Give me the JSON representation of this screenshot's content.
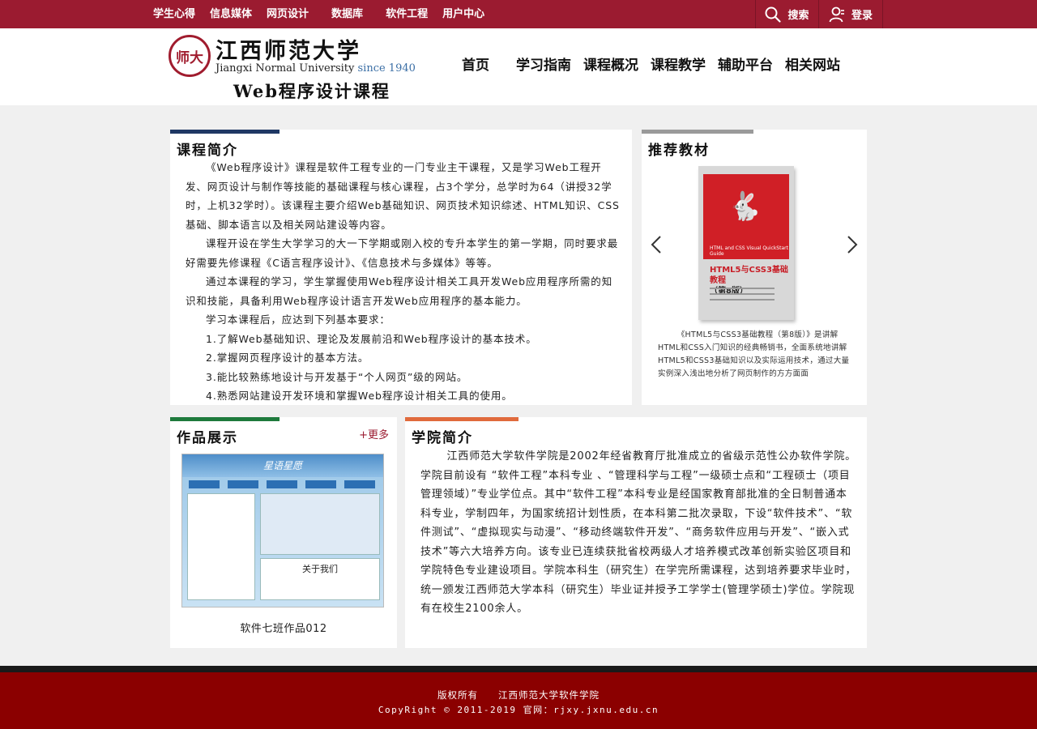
{
  "topnav": {
    "items": [
      "学生心得",
      "信息媒体",
      "网页设计",
      "数据库",
      "软件工程",
      "用户中心"
    ],
    "search_label": "搜索",
    "login_label": "登录"
  },
  "header": {
    "logo_name": "江西师范大学",
    "logo_en": "Jiangxi Normal University",
    "logo_since": "since 1940",
    "logo_seal": "师大",
    "course_title": "Web程序设计课程",
    "nav": [
      "首页",
      "学习指南",
      "课程概况",
      "课程教学",
      "辅助平台",
      "相关网站"
    ]
  },
  "intro": {
    "title": "课程简介",
    "paragraphs": [
      "《Web程序设计》课程是软件工程专业的一门专业主干课程，又是学习Web工程开发、网页设计与制作等技能的基础课程与核心课程，占3个学分，总学时为64（讲授32学时，上机32学时）。该课程主要介绍Web基础知识、网页技术知识综述、HTML知识、CSS基础、脚本语言以及相关网站建设等内容。",
      "课程开设在学生大学学习的大一下学期或刚入校的专升本学生的第一学期，同时要求最好需要先修课程《C语言程序设计》、《信息技术与多媒体》等等。",
      "通过本课程的学习，学生掌握使用Web程序设计相关工具开发Web应用程序所需的知识和技能，具备利用Web程序设计语言开发Web应用程序的基本能力。",
      "学习本课程后，应达到下列基本要求："
    ],
    "requirements": [
      "1.了解Web基础知识、理论及发展前沿和Web程序设计的基本技术。",
      "2.掌握网页程序设计的基本方法。",
      "3.能比较熟练地设计与开发基于“个人网页”级的网站。",
      "4.熟悉网站建设开发环境和掌握Web程序设计相关工具的使用。"
    ]
  },
  "book": {
    "title": "推荐教材",
    "cover_title": "HTML5与CSS3基础教程",
    "cover_edition": "（第8版）",
    "cover_sub": "HTML and CSS Visual QuickStart Guide",
    "description": "《HTML5与CSS3基础教程（第8版）》是讲解HTML和CSS入门知识的经典畅销书，全面系统地讲解HTML5和CSS3基础知识以及实际运用技术，通过大量实例深入浅出地分析了网页制作的方方面面"
  },
  "works": {
    "title": "作品展示",
    "more_label": "+更多",
    "caption": "软件七班作品012",
    "banner": "星语星愿",
    "about": "关于我们"
  },
  "college": {
    "title": "学院简介",
    "text": "江西师范大学软件学院是2002年经省教育厅批准成立的省级示范性公办软件学院。学院目前设有 “软件工程”本科专业 、“管理科学与工程”一级硕士点和“工程硕士（项目管理领域）”专业学位点。其中“软件工程”本科专业是经国家教育部批准的全日制普通本科专业，学制四年，为国家统招计划性质，在本科第二批次录取，下设“软件技术”、“软件测试”、“虚拟现实与动漫”、“移动终端软件开发”、“商务软件应用与开发”、“嵌入式技术”等六大培养方向。该专业已连续获批省校两级人才培养模式改革创新实验区项目和学院特色专业建设项目。学院本科生（研究生）在学完所需课程，达到培养要求毕业时，统一颁发江西师范大学本科（研究生）毕业证并授予工学学士(管理学硕士)学位。学院现有在校生2100余人。"
  },
  "footer": {
    "line1": "版权所有　　江西师范大学软件学院",
    "line2": "CopyRight  ©  2011-2019   官网：rjxy.jxnu.edu.cn"
  },
  "colors": {
    "topbar": "#9b1b30",
    "intro_accent": "#1f3864",
    "book_accent": "#9a9a9a",
    "works_accent": "#1e7a3c",
    "college_accent": "#e06a3c",
    "footer": "#8b0000"
  }
}
